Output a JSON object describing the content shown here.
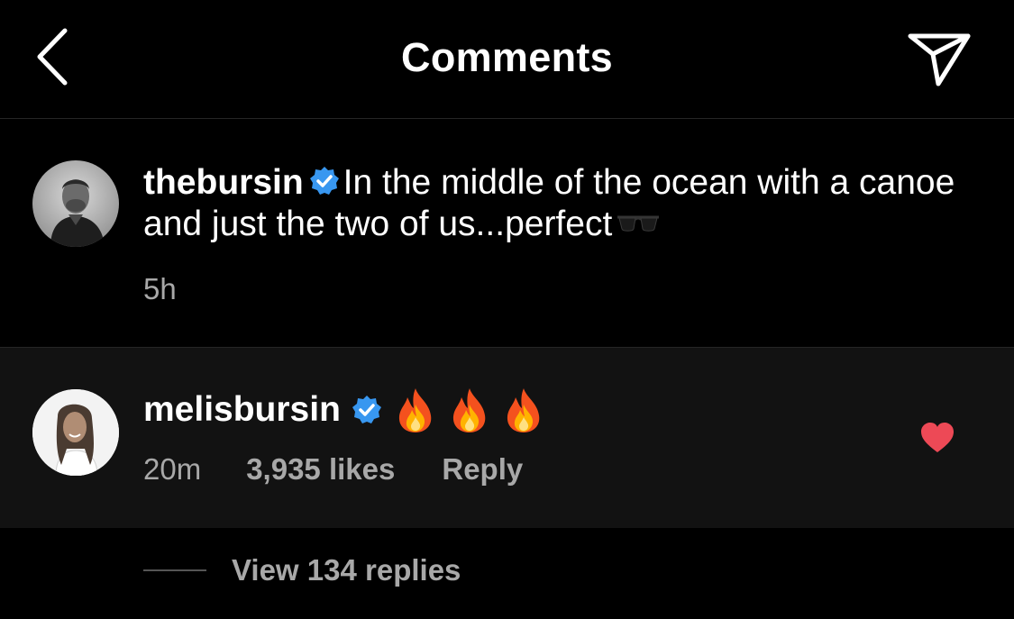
{
  "header": {
    "title": "Comments",
    "back_icon": "chevron-left-icon",
    "send_icon": "paper-plane-icon"
  },
  "caption": {
    "username": "thebursin",
    "verified_icon": "verified-badge-icon",
    "text": "In the middle of the ocean with a canoe and just the two of us...perfect",
    "emoji": "sunglasses-icon",
    "time": "5h"
  },
  "comment": {
    "username": "melisbursin",
    "verified_icon": "verified-badge-icon",
    "emojis": [
      "fire-icon",
      "fire-icon",
      "fire-icon"
    ],
    "time": "20m",
    "likes": "3,935 likes",
    "reply_label": "Reply",
    "liked": true
  },
  "replies": {
    "label": "View 134 replies"
  },
  "colors": {
    "background": "#000000",
    "comment_background": "#121212",
    "secondary_text": "#a8a8a8",
    "verified_blue": "#3897f0",
    "like_red": "#ed4956"
  }
}
